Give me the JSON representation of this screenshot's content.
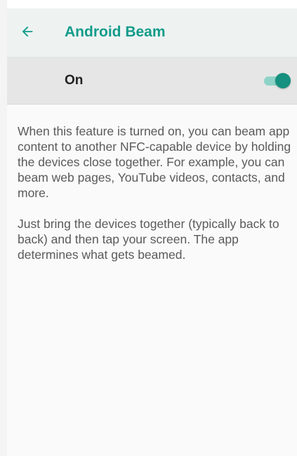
{
  "header": {
    "title": "Android Beam",
    "back_icon": "arrow-back-icon"
  },
  "toggle": {
    "label": "On",
    "state": "on",
    "accent_color": "#16907f"
  },
  "description": {
    "paragraph_1": "When this feature is turned on, you can beam app content to another NFC-capable device by holding the devices close together. For example, you can beam web pages, YouTube videos, contacts, and more.",
    "paragraph_2": "Just bring the devices together (typically back to back) and then tap your screen. The app determines what gets beamed."
  },
  "colors": {
    "title": "#129c8a",
    "app_bar_bg": "#eef3f2",
    "toggle_row_bg": "#e6e6e6",
    "body_text": "#5a5a5a"
  }
}
